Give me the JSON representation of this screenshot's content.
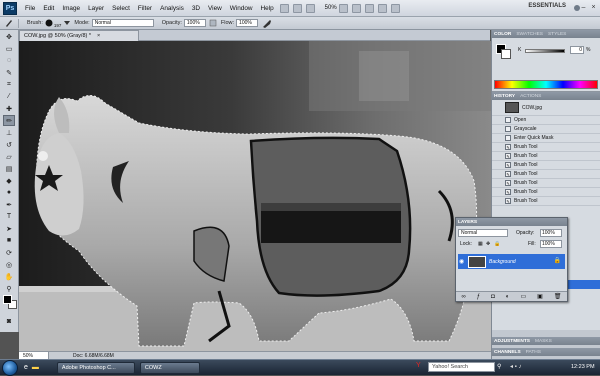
{
  "menubar": {
    "logo": "Ps",
    "items": [
      "File",
      "Edit",
      "Image",
      "Layer",
      "Select",
      "Filter",
      "Analysis",
      "3D",
      "View",
      "Window",
      "Help"
    ],
    "zoom": "50%",
    "workspace": "ESSENTIALS"
  },
  "options": {
    "brush_label": "Brush:",
    "brush_size": "197",
    "mode_label": "Mode:",
    "mode_value": "Normal",
    "opacity_label": "Opacity:",
    "opacity_value": "100%",
    "flow_label": "Flow:",
    "flow_value": "100%"
  },
  "document": {
    "tab_title": "COW.jpg @ 50% (Gray/8) *",
    "status_zoom": "50%",
    "status_doc": "Doc: 6.68M/6.68M"
  },
  "color_panel": {
    "tabs": [
      "COLOR",
      "SWATCHES",
      "STYLES"
    ],
    "k_label": "K",
    "k_value": "0",
    "k_unit": "%"
  },
  "history_panel": {
    "tabs": [
      "HISTORY",
      "ACTIONS"
    ],
    "snapshot": "COW.jpg",
    "items": [
      "Open",
      "Grayscale",
      "Enter Quick Mask",
      "Brush Tool",
      "Brush Tool",
      "Brush Tool",
      "Brush Tool",
      "Brush Tool",
      "Brush Tool",
      "Brush Tool"
    ]
  },
  "layers_panel": {
    "title": "LAYERS",
    "blend_mode": "Normal",
    "opacity_label": "Opacity:",
    "opacity_value": "100%",
    "lock_label": "Lock:",
    "fill_label": "Fill:",
    "fill_value": "100%",
    "layer_name": "Background"
  },
  "bottom_tabs": {
    "adj": [
      "ADJUSTMENTS",
      "MASKS"
    ],
    "chan": [
      "CHANNELS",
      "PATHS"
    ]
  },
  "taskbar": {
    "tasks": [
      "Adobe Photoshop C...",
      "COWZ"
    ],
    "search_placeholder": "Yahoo! Search",
    "clock": "12:23 PM"
  }
}
